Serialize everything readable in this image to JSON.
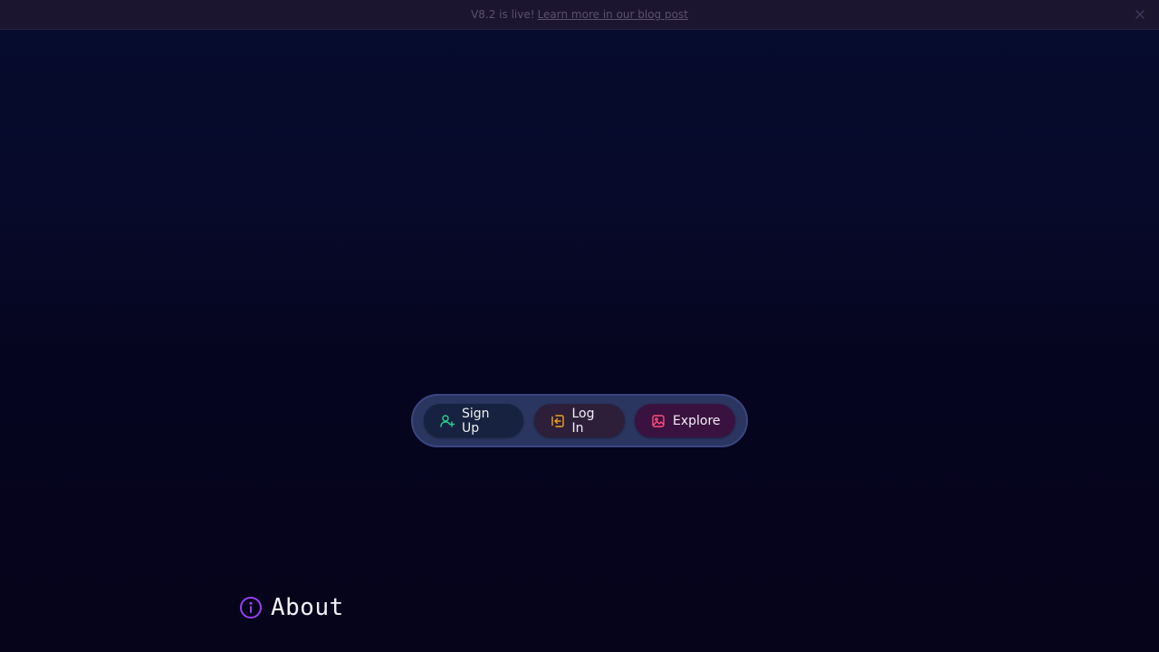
{
  "announcement": {
    "message": "V8.2 is live!",
    "link_text": "Learn more in our blog post",
    "close_icon": "close-icon"
  },
  "actions": [
    {
      "label": "Sign Up",
      "icon": "user-plus-icon",
      "color": "#2ecc8a"
    },
    {
      "label": "Log In",
      "icon": "login-icon",
      "color": "#f0a020"
    },
    {
      "label": "Explore",
      "icon": "image-icon",
      "color": "#ff4d7a"
    }
  ],
  "about": {
    "title": "About",
    "icon": "info-icon",
    "icon_color": "#9b3df5"
  }
}
